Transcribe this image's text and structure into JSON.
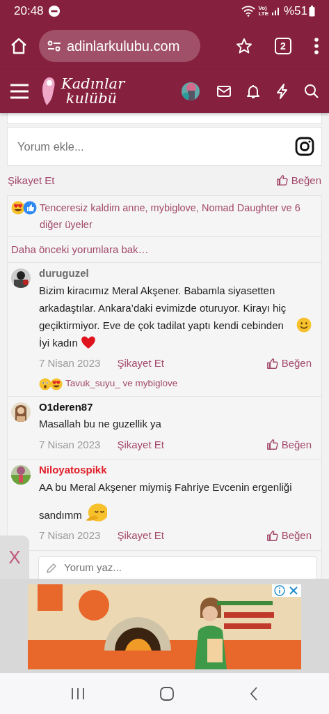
{
  "status_bar": {
    "time": "20:48",
    "network": [
      "Vo)",
      "LTE"
    ],
    "battery": "%51"
  },
  "browser": {
    "url": "adinlarkulubu.com",
    "tab_count": "2"
  },
  "site_header": {
    "logo": [
      "Kadınlar",
      "kulübü"
    ]
  },
  "comment_box": {
    "placeholder": "Yorum ekle..."
  },
  "post_actions": {
    "report": "Şikayet Et",
    "like": "Beğen"
  },
  "reactions": {
    "icons": [
      {
        "kind": "heart-eyes"
      },
      {
        "kind": "like"
      }
    ],
    "text": "Tenceresiz kaldim anne, mybiglove, Nomad Daughter ve 6 diğer üyeler"
  },
  "more_comments": "Daha önceki yorumlara bak…",
  "comments": [
    {
      "author": "duruguzel",
      "color": "#6b6b6b",
      "body": [
        {
          "kind": "text",
          "text": "Bizim kiracımız Meral Akşener. Babamla siyasetten arkadaştılar. Ankara’daki evimizde oturuyor. Kirayı hiç geçiktirmiyor. Eve de çok tadilat yaptı kendi cebinden"
        },
        {
          "kind": "smiley"
        },
        {
          "kind": "break"
        },
        {
          "kind": "text",
          "text": "İyi kadın"
        },
        {
          "kind": "heart"
        }
      ],
      "date": "7 Nisan 2023",
      "report": "Şikayet Et",
      "like": "Beğen",
      "reactions": {
        "icons": [
          {
            "kind": "surprised"
          },
          {
            "kind": "heart-eyes"
          }
        ],
        "text": "Tavuk_suyu_ ve mybiglove"
      }
    },
    {
      "author": "O1deren87",
      "color": "#111111",
      "body": [
        {
          "kind": "text",
          "text": "Masallah bu ne guzellik ya"
        }
      ],
      "date": "7 Nisan 2023",
      "report": "Şikayet Et",
      "like": "Beğen"
    },
    {
      "author": "Niloyatospikk",
      "color": "#e0202a",
      "body": [
        {
          "kind": "text",
          "text": "AA bu Meral Akşener miymiş Fahriye Evcenin ergenliği"
        },
        {
          "kind": "break"
        },
        {
          "kind": "text",
          "text": "sandımm"
        },
        {
          "kind": "facepalm"
        }
      ],
      "date": "7 Nisan 2023",
      "report": "Şikayet Et",
      "like": "Beğen"
    }
  ],
  "reply_box": {
    "placeholder": "Yorum yaz..."
  },
  "ad_close": "X"
}
